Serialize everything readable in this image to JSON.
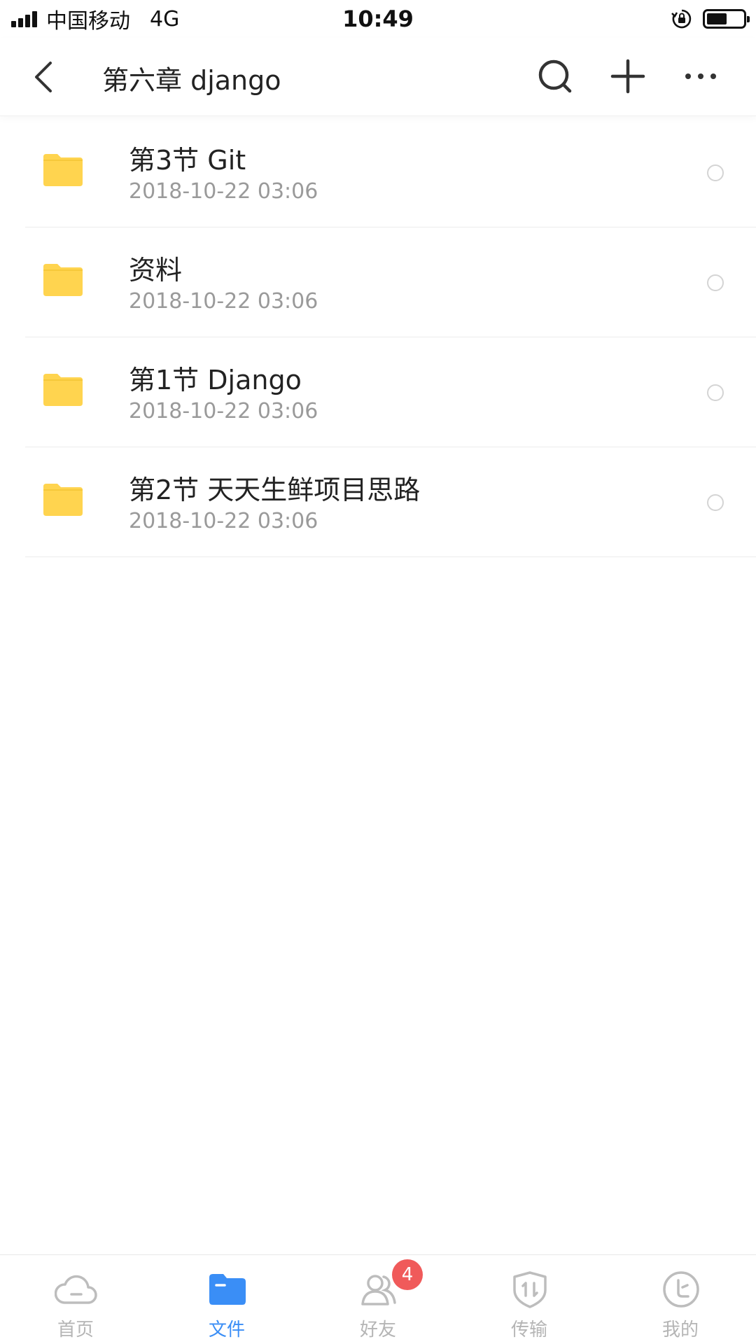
{
  "status_bar": {
    "carrier": "中国移动",
    "network": "4G",
    "time": "10:49",
    "battery_level": 0.55
  },
  "nav": {
    "title": "第六章  django",
    "icons": [
      "back-icon",
      "search-icon",
      "plus-icon",
      "more-icon"
    ]
  },
  "files": [
    {
      "name": "第3节 Git",
      "date": "2018-10-22 03:06",
      "icon": "folder-icon"
    },
    {
      "name": "资料",
      "date": "2018-10-22 03:06",
      "icon": "folder-icon"
    },
    {
      "name": "第1节 Django",
      "date": "2018-10-22 03:06",
      "icon": "folder-icon"
    },
    {
      "name": "第2节 天天生鲜项目思路",
      "date": "2018-10-22 03:06",
      "icon": "folder-icon"
    }
  ],
  "tabs": [
    {
      "label": "首页",
      "icon": "cloud-icon",
      "active": false
    },
    {
      "label": "文件",
      "icon": "folder-icon",
      "active": true
    },
    {
      "label": "好友",
      "icon": "friends-icon",
      "active": false,
      "badge": "4"
    },
    {
      "label": "传输",
      "icon": "transfer-icon",
      "active": false
    },
    {
      "label": "我的",
      "icon": "profile-icon",
      "active": false
    }
  ],
  "colors": {
    "folder": "#FFD44F",
    "accent": "#3A8EF6",
    "badge": "#F05A5A",
    "inactive": "#B5B5B5"
  }
}
